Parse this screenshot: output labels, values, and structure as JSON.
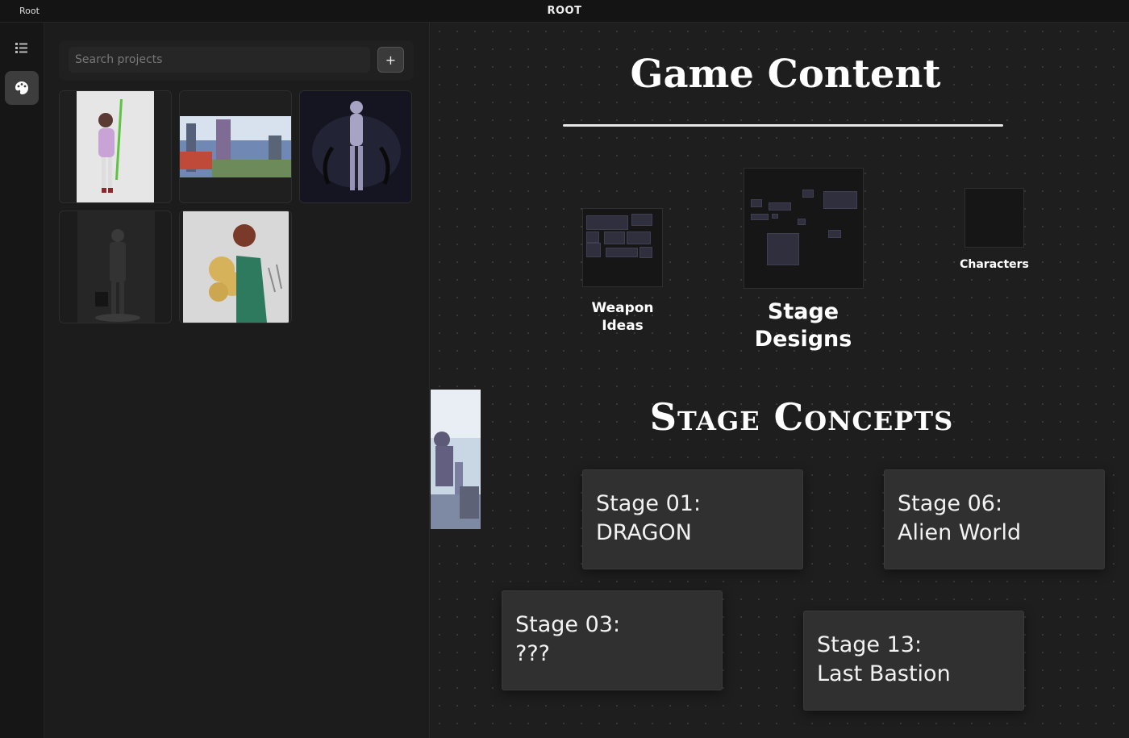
{
  "titlebar": {
    "breadcrumb": "Root",
    "title": "ROOT"
  },
  "rail": {
    "icons": [
      "list-icon",
      "palette-icon"
    ]
  },
  "panel": {
    "search": {
      "placeholder": "Search projects"
    },
    "add_label": "+",
    "thumbnails": [
      "character-sketch",
      "landscape-painting",
      "dark-figure",
      "robot-figure",
      "blonde-character-sketch"
    ]
  },
  "canvas": {
    "heading": "Game Content",
    "boards": [
      {
        "label": "Weapon Ideas"
      },
      {
        "label": "Stage Designs"
      },
      {
        "label": "Characters"
      }
    ],
    "stage_heading": "Stage Concepts",
    "cards": [
      {
        "line1": "Stage 01:",
        "line2": "DRAGON"
      },
      {
        "line1": "Stage 06:",
        "line2": "Alien World"
      },
      {
        "line1": "Stage 03:",
        "line2": "???"
      },
      {
        "line1": "Stage 13:",
        "line2": "Last Bastion"
      }
    ]
  }
}
